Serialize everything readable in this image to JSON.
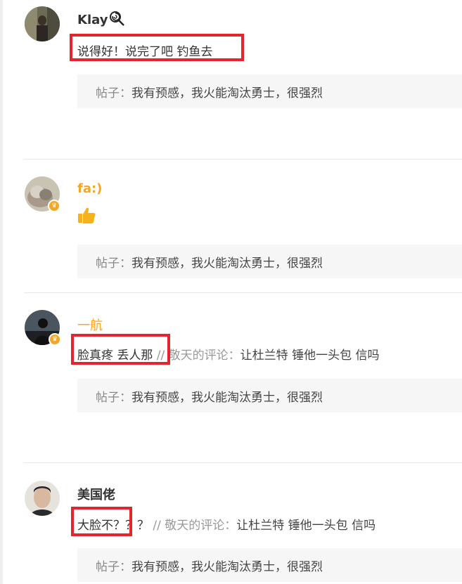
{
  "post_prefix": "帖子：",
  "comments": [
    {
      "username": "Klay",
      "text": "说得好！说完了吧 钓鱼去",
      "post_title": "我有预感，我火能淘汰勇士，很强烈"
    },
    {
      "username": "fa:)",
      "post_title": "我有预感，我火能淘汰勇士，很强烈"
    },
    {
      "username": "一航",
      "text": "脸真疼 丢人那",
      "reply_sep": " // ",
      "reply_author": "敬天的评论：",
      "reply_body": "让杜兰特 锤他一头包 信吗",
      "post_title": "我有预感，我火能淘汰勇士，很强烈"
    },
    {
      "username": "美国佬",
      "text": "大脸不？",
      "text_extra": "？？",
      "reply_sep": " // ",
      "reply_author": "敬天的评论：",
      "reply_body": "让杜兰特 锤他一头包 信吗",
      "post_title": "我有预感，我火能淘汰勇士，很强烈"
    }
  ],
  "colors": {
    "highlight": "#e3262d",
    "username_orange": "#f5a623",
    "post_bg": "#f6f6f6"
  }
}
